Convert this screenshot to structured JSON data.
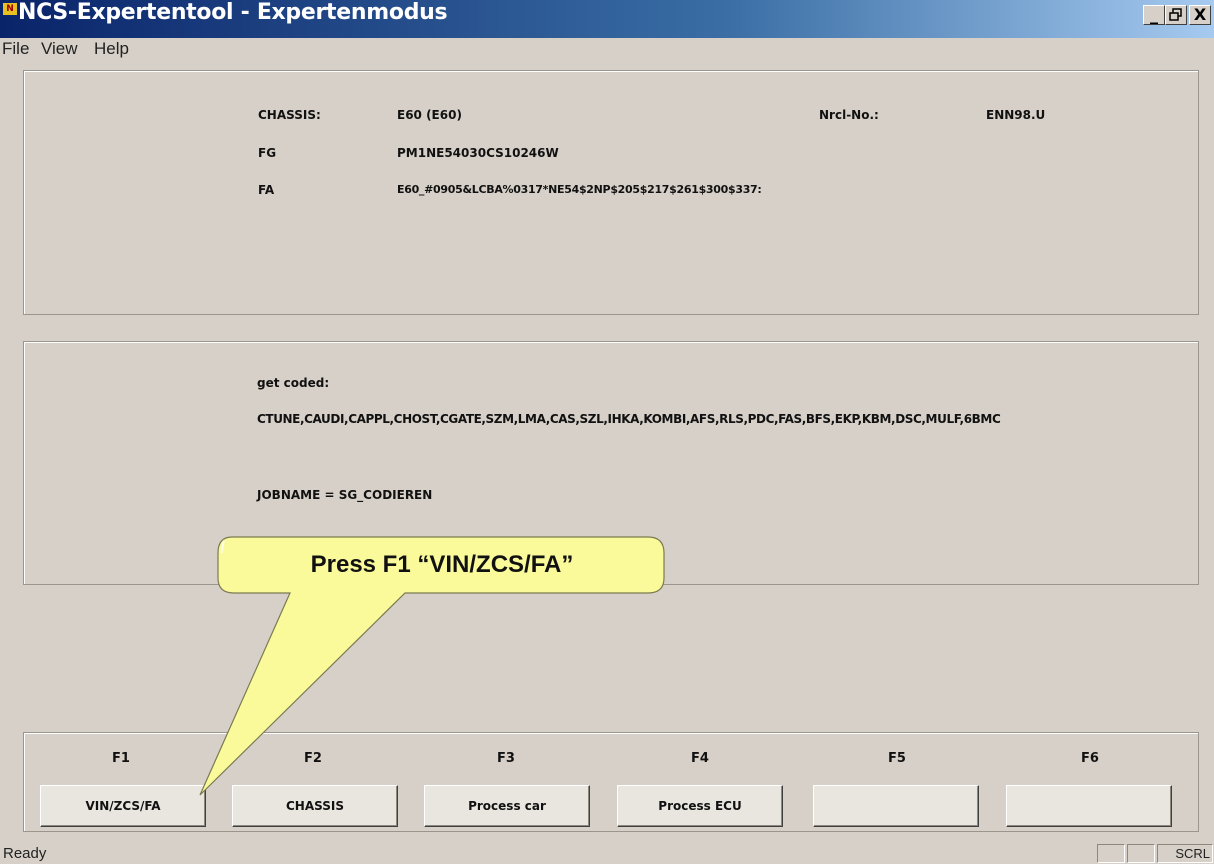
{
  "window": {
    "icon": "app-icon",
    "title": "NCS-Expertentool - Expertenmodus",
    "controls": {
      "minimize": "_",
      "maximize": "🗗",
      "close": "X"
    }
  },
  "menu": [
    "File",
    "View",
    "Help"
  ],
  "vehicle_info": {
    "chassis_label": "CHASSIS:",
    "chassis_value": "E60 (E60)",
    "nrcl_label": "Nrcl-No.:",
    "nrcl_value": "ENN98.U",
    "fg_label": "FG",
    "fg_value": "PM1NE54030CS10246W",
    "fa_label": "FA",
    "fa_value": "E60_#0905&LCBA%0317*NE54$2NP$205$217$261$300$337:"
  },
  "job_info": {
    "heading": "get coded:",
    "modules": "CTUNE,CAUDI,CAPPL,CHOST,CGATE,SZM,LMA,CAS,SZL,IHKA,KOMBI,AFS,RLS,PDC,FAS,BFS,EKP,KBM,DSC,MULF,6BMC",
    "jobname": "JOBNAME = SG_CODIEREN"
  },
  "callout": {
    "text": "Press F1 “VIN/ZCS/FA”",
    "color": "#fafa9a"
  },
  "function_keys": [
    {
      "key": "F1",
      "label": "VIN/ZCS/FA"
    },
    {
      "key": "F2",
      "label": "CHASSIS"
    },
    {
      "key": "F3",
      "label": "Process car"
    },
    {
      "key": "F4",
      "label": "Process ECU"
    },
    {
      "key": "F5",
      "label": ""
    },
    {
      "key": "F6",
      "label": ""
    }
  ],
  "status": {
    "text": "Ready",
    "indicator": "SCRL"
  },
  "colors": {
    "background": "#d6d0c8",
    "titlebar": "#0a246a"
  }
}
